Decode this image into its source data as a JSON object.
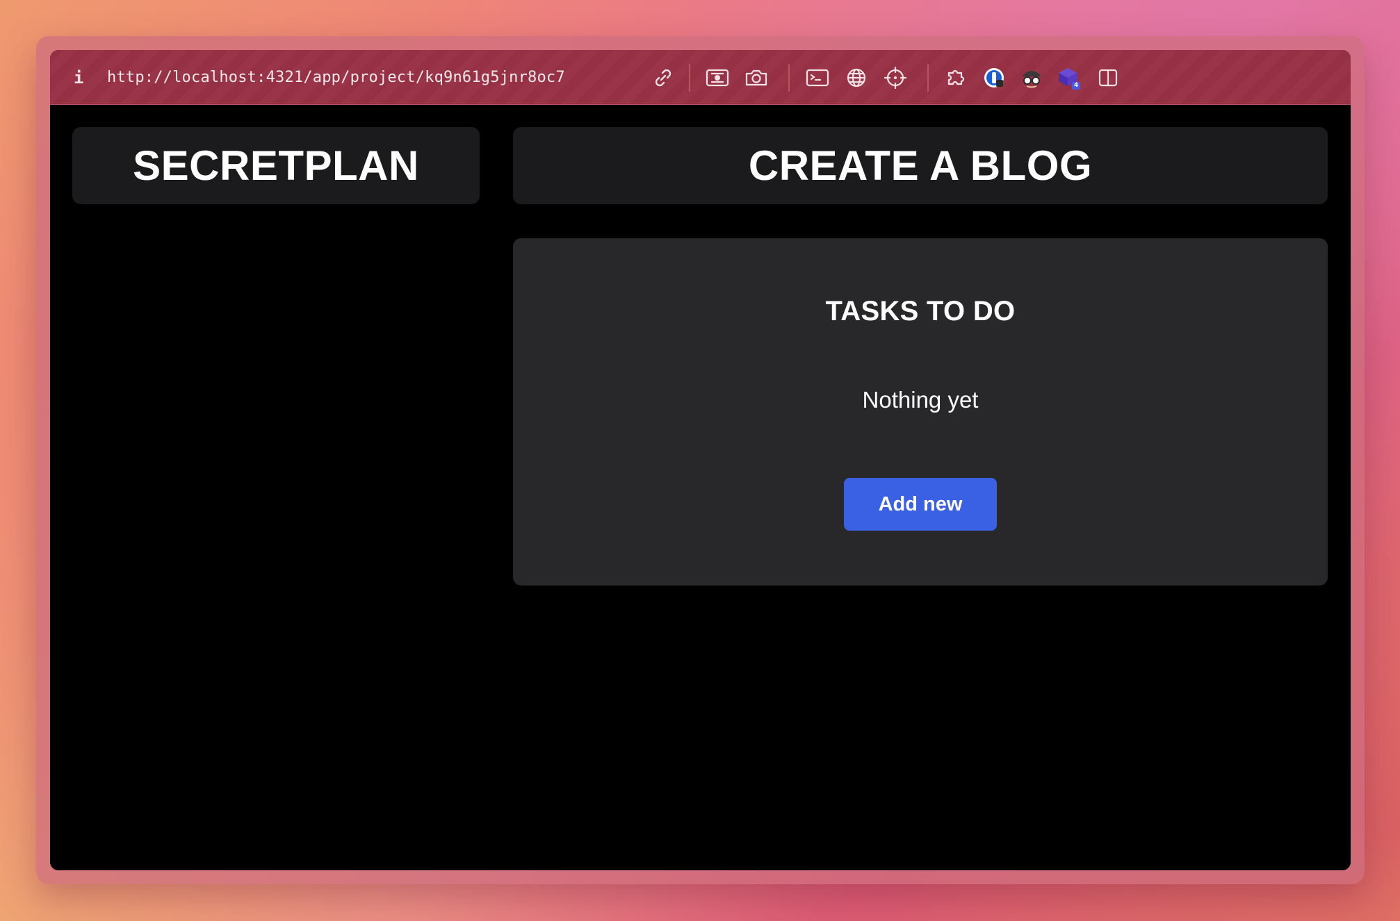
{
  "browser": {
    "url": "http://localhost:4321/app/project/kq9n61g5jnr8oc7",
    "toolbar_icons": [
      "link-icon",
      "image-capture-icon",
      "camera-icon",
      "terminal-icon",
      "globe-icon",
      "crosshair-icon",
      "extensions-puzzle-icon",
      "password-manager-icon",
      "incognito-spy-icon",
      "cube-extension-icon",
      "sidebar-toggle-icon"
    ],
    "extension_badge": "4"
  },
  "project": {
    "name": "SECRETPLAN"
  },
  "task": {
    "title": "CREATE A BLOG"
  },
  "tasks_panel": {
    "heading": "TASKS TO DO",
    "empty_message": "Nothing yet",
    "add_button_label": "Add new"
  },
  "colors": {
    "toolbar_bg": "#963145",
    "app_bg": "#000000",
    "card_bg": "#1b1b1d",
    "panel_bg": "#28282a",
    "primary_button": "#3a60e4",
    "text": "#ffffff"
  }
}
